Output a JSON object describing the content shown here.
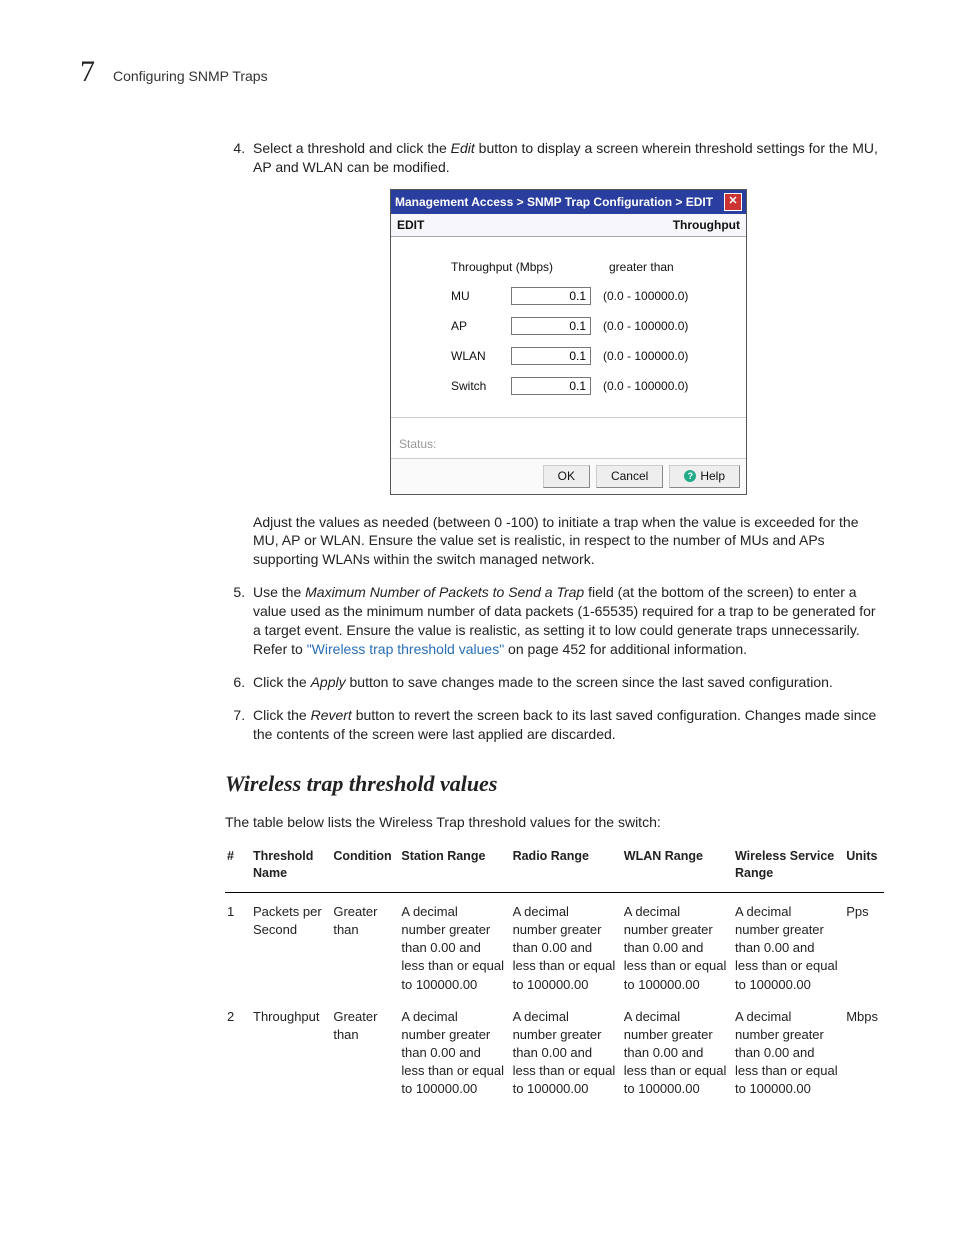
{
  "header": {
    "chapter_number": "7",
    "chapter_title": "Configuring SNMP Traps"
  },
  "steps": {
    "s4": {
      "num": "4.",
      "text_a": "Select a threshold and click the ",
      "italic": "Edit",
      "text_b": " button to display a screen wherein threshold settings for the MU, AP and WLAN can be modified."
    },
    "s4b": "Adjust the values as needed (between 0 -100) to initiate a trap when the value is exceeded for the MU, AP or WLAN. Ensure the value set is realistic, in respect to the number of MUs and APs supporting WLANs within the switch managed network.",
    "s5": {
      "text_a": "Use the ",
      "italic": "Maximum Number of Packets to Send a Trap",
      "text_b": " field (at the bottom of the screen) to enter a value used as the minimum number of data packets (1-65535) required for a trap to be generated for a target event. Ensure the value is realistic, as setting it to low could generate traps unnecessarily. Refer to ",
      "link": "\"Wireless trap threshold values\"",
      "text_c": " on page 452 for additional information."
    },
    "s6": {
      "text_a": "Click the ",
      "italic": "Apply",
      "text_b": " button to save changes made to the screen since the last saved configuration."
    },
    "s7": {
      "text_a": "Click the ",
      "italic": "Revert",
      "text_b": " button to revert the screen back to its last saved configuration. Changes made since the contents of the screen were last applied are discarded."
    }
  },
  "dialog": {
    "title": "Management Access > SNMP Trap Configuration > EDIT",
    "sub_left": "EDIT",
    "sub_right": "Throughput",
    "col_left": "Throughput (Mbps)",
    "col_right": "greater than",
    "rows": [
      {
        "label": "MU",
        "value": "0.1",
        "range": "(0.0 - 100000.0)"
      },
      {
        "label": "AP",
        "value": "0.1",
        "range": "(0.0 - 100000.0)"
      },
      {
        "label": "WLAN",
        "value": "0.1",
        "range": "(0.0 - 100000.0)"
      },
      {
        "label": "Switch",
        "value": "0.1",
        "range": "(0.0 - 100000.0)"
      }
    ],
    "status_label": "Status:",
    "btn_ok": "OK",
    "btn_cancel": "Cancel",
    "btn_help": "Help"
  },
  "section_title": "Wireless trap threshold values",
  "section_intro": "The table below lists the Wireless Trap threshold values for the switch:",
  "table": {
    "headers": [
      "#",
      "Threshold Name",
      "Condition",
      "Station Range",
      "Radio Range",
      "WLAN Range",
      "Wireless Service Range",
      "Units"
    ],
    "rows": [
      {
        "num": "1",
        "name": "Packets per Second",
        "condition": "Greater than",
        "station": "A decimal number greater than 0.00 and less than or equal to 100000.00",
        "radio": "A decimal number greater than 0.00 and less than or equal to 100000.00",
        "wlan": "A decimal number greater than 0.00 and less than or equal to 100000.00",
        "service": "A decimal number greater than 0.00 and less than or equal to 100000.00",
        "units": "Pps"
      },
      {
        "num": "2",
        "name": "Throughput",
        "condition": "Greater than",
        "station": "A decimal number greater than 0.00 and less than or equal to 100000.00",
        "radio": "A decimal number greater than 0.00 and less than or equal to 100000.00",
        "wlan": "A decimal number greater than 0.00 and less than or equal to 100000.00",
        "service": "A decimal number greater than 0.00 and less than or equal to 100000.00",
        "units": "Mbps"
      }
    ]
  }
}
